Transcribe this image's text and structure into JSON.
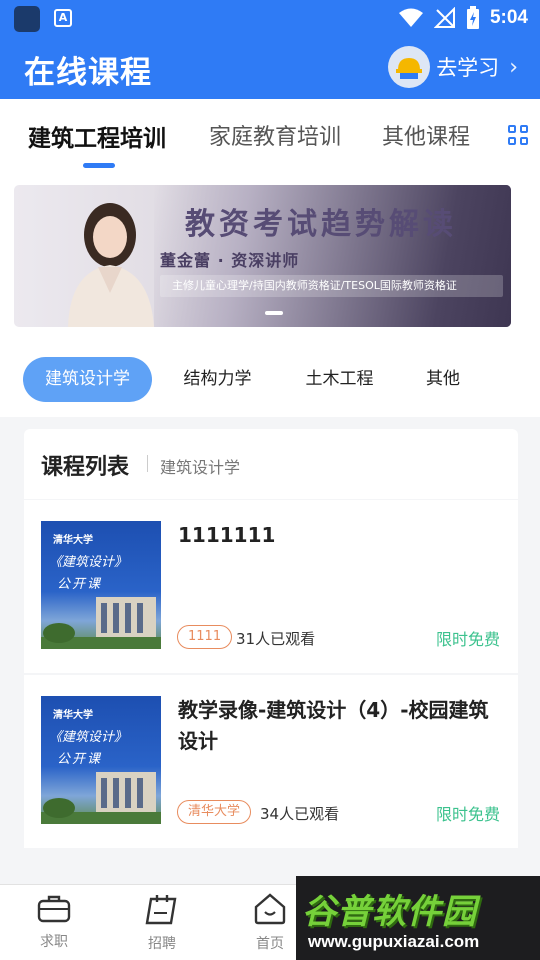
{
  "status_bar": {
    "time": "5:04",
    "app_badge": "A"
  },
  "header": {
    "title": "在线课程",
    "go_study_label": "去学习"
  },
  "tabs": [
    {
      "label": "建筑工程培训",
      "active": true
    },
    {
      "label": "家庭教育培训",
      "active": false
    },
    {
      "label": "其他课程",
      "active": false
    }
  ],
  "banner": {
    "title": "教资考试趋势解读",
    "teacher": "董金蕾 · 资深讲师",
    "qualifications": "主修儿童心理学/持国内教师资格证/TESOL国际教师资格证"
  },
  "chips": [
    {
      "label": "建筑设计学",
      "active": true
    },
    {
      "label": "结构力学",
      "active": false
    },
    {
      "label": "土木工程",
      "active": false
    },
    {
      "label": "其他",
      "active": false
    }
  ],
  "course_list": {
    "title": "课程列表",
    "subtitle": "建筑设计学",
    "courses": [
      {
        "title": "1111111",
        "tag": "1111",
        "views": "31人已观看",
        "price_label": "限时免费",
        "thumb": {
          "school": "清华大学",
          "name": "《建筑设计》",
          "open": "公开课"
        }
      },
      {
        "title": "教学录像-建筑设计（4）-校园建筑设计",
        "tag": "清华大学",
        "views": "34人已观看",
        "price_label": "限时免费",
        "thumb": {
          "school": "清华大学",
          "name": "《建筑设计》",
          "open": "公开课"
        }
      }
    ]
  },
  "bottom_nav": [
    {
      "label": "求职",
      "icon": "briefcase-icon"
    },
    {
      "label": "招聘",
      "icon": "notepad-icon"
    },
    {
      "label": "首页",
      "icon": "home-icon"
    }
  ],
  "watermark": {
    "brand": "谷普软件园",
    "url": "www.gupuxiazai.com"
  },
  "colors": {
    "primary": "#2f7bf5",
    "chip_active": "#5fa2f6",
    "free": "#3cc28e",
    "tag": "#e88c5e"
  }
}
